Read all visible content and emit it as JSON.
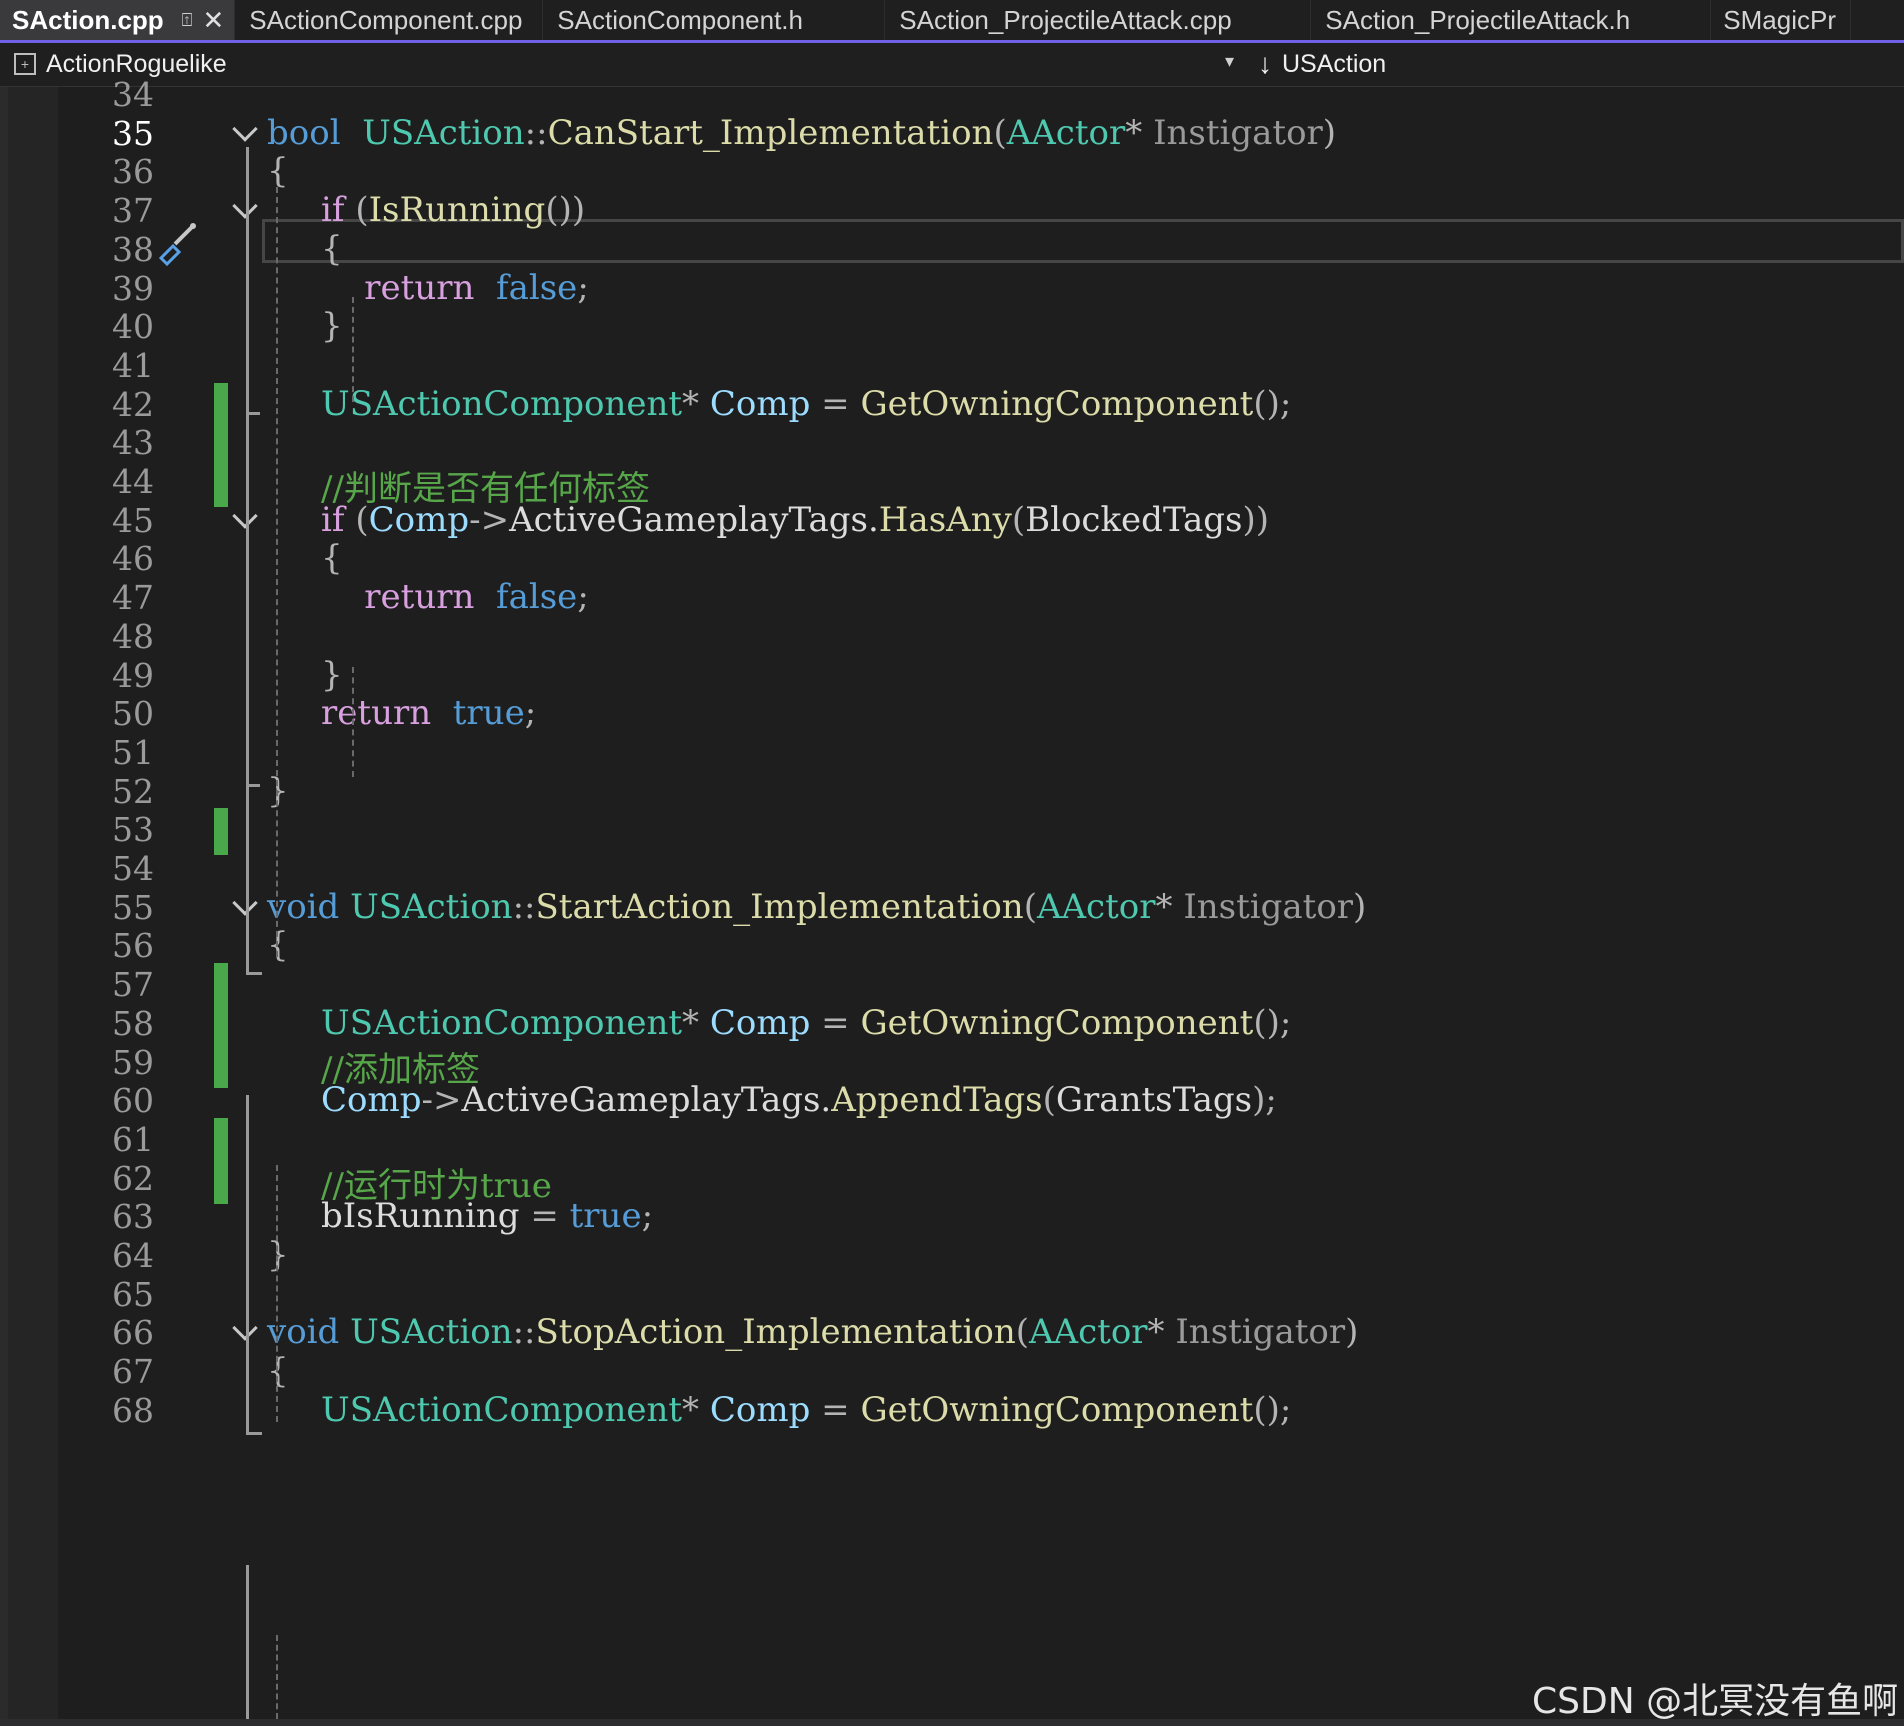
{
  "tabs": [
    {
      "label": "SAction.cpp",
      "active": true
    },
    {
      "label": "SActionComponent.cpp"
    },
    {
      "label": "SActionComponent.h"
    },
    {
      "label": "SAction_ProjectileAttack.cpp"
    },
    {
      "label": "SAction_ProjectileAttack.h"
    },
    {
      "label": "SMagicPr"
    }
  ],
  "navbar": {
    "project": "ActionRoguelike",
    "scope": "USAction"
  },
  "editor": {
    "current_line": "35",
    "lines": [
      {
        "n": "34"
      },
      {
        "n": "35",
        "t": [
          [
            "kw",
            "bool"
          ],
          [
            "",
            "  "
          ],
          [
            "ty",
            "USAction"
          ],
          [
            "pn",
            "::"
          ],
          [
            "fn",
            "CanStart_Implementation"
          ],
          [
            "pn",
            "("
          ],
          [
            "ty",
            "AActor"
          ],
          [
            "pn",
            "* "
          ],
          [
            "prm",
            "Instigator"
          ],
          [
            "pn",
            ")"
          ]
        ]
      },
      {
        "n": "36",
        "t": [
          [
            "pn",
            "{"
          ]
        ]
      },
      {
        "n": "37",
        "t": [
          [
            "",
            "     "
          ],
          [
            "ctl",
            "if"
          ],
          [
            "pn",
            " ("
          ],
          [
            "fn",
            "IsRunning"
          ],
          [
            "pn",
            "())"
          ]
        ]
      },
      {
        "n": "38",
        "t": [
          [
            "",
            "     "
          ],
          [
            "pn",
            "{"
          ]
        ]
      },
      {
        "n": "39",
        "t": [
          [
            "",
            "         "
          ],
          [
            "ctl",
            "return"
          ],
          [
            "",
            "  "
          ],
          [
            "kw",
            "false"
          ],
          [
            "pn",
            ";"
          ]
        ]
      },
      {
        "n": "40",
        "t": [
          [
            "",
            "     "
          ],
          [
            "pn",
            "}"
          ]
        ]
      },
      {
        "n": "41"
      },
      {
        "n": "42",
        "t": [
          [
            "",
            "     "
          ],
          [
            "ty",
            "USActionComponent"
          ],
          [
            "pn",
            "* "
          ],
          [
            "var",
            "Comp"
          ],
          [
            "pn",
            " = "
          ],
          [
            "fn",
            "GetOwningComponent"
          ],
          [
            "pn",
            "();"
          ]
        ]
      },
      {
        "n": "43"
      },
      {
        "n": "44",
        "t": [
          [
            "",
            "     "
          ],
          [
            "cm",
            "//判断是否有任何标签"
          ]
        ]
      },
      {
        "n": "45",
        "t": [
          [
            "",
            "     "
          ],
          [
            "ctl",
            "if"
          ],
          [
            "pn",
            " ("
          ],
          [
            "var",
            "Comp"
          ],
          [
            "pn",
            "->"
          ],
          [
            "",
            "ActiveGameplayTags."
          ],
          [
            "fn",
            "HasAny"
          ],
          [
            "pn",
            "("
          ],
          [
            "",
            "BlockedTags"
          ],
          [
            "pn",
            "))"
          ]
        ]
      },
      {
        "n": "46",
        "t": [
          [
            "",
            "     "
          ],
          [
            "pn",
            "{"
          ]
        ]
      },
      {
        "n": "47",
        "t": [
          [
            "",
            "         "
          ],
          [
            "ctl",
            "return"
          ],
          [
            "",
            "  "
          ],
          [
            "kw",
            "false"
          ],
          [
            "pn",
            ";"
          ]
        ]
      },
      {
        "n": "48"
      },
      {
        "n": "49",
        "t": [
          [
            "",
            "     "
          ],
          [
            "pn",
            "}"
          ]
        ]
      },
      {
        "n": "50",
        "t": [
          [
            "",
            "     "
          ],
          [
            "ctl",
            "return"
          ],
          [
            "",
            "  "
          ],
          [
            "kw",
            "true"
          ],
          [
            "pn",
            ";"
          ]
        ]
      },
      {
        "n": "51"
      },
      {
        "n": "52",
        "t": [
          [
            "pn",
            "}"
          ]
        ]
      },
      {
        "n": "53"
      },
      {
        "n": "54"
      },
      {
        "n": "55",
        "t": [
          [
            "kw",
            "void"
          ],
          [
            "",
            ""
          ],
          [
            "ty",
            " USAction"
          ],
          [
            "pn",
            "::"
          ],
          [
            "fn",
            "StartAction_Implementation"
          ],
          [
            "pn",
            "("
          ],
          [
            "ty",
            "AActor"
          ],
          [
            "pn",
            "* "
          ],
          [
            "prm",
            "Instigator"
          ],
          [
            "pn",
            ")"
          ]
        ]
      },
      {
        "n": "56",
        "t": [
          [
            "pn",
            "{"
          ]
        ]
      },
      {
        "n": "57"
      },
      {
        "n": "58",
        "t": [
          [
            "",
            "     "
          ],
          [
            "ty",
            "USActionComponent"
          ],
          [
            "pn",
            "* "
          ],
          [
            "var",
            "Comp"
          ],
          [
            "pn",
            " = "
          ],
          [
            "fn",
            "GetOwningComponent"
          ],
          [
            "pn",
            "();"
          ]
        ]
      },
      {
        "n": "59",
        "t": [
          [
            "",
            "     "
          ],
          [
            "cm",
            "//添加标签"
          ]
        ]
      },
      {
        "n": "60",
        "t": [
          [
            "",
            "     "
          ],
          [
            "var",
            "Comp"
          ],
          [
            "pn",
            "->"
          ],
          [
            "",
            "ActiveGameplayTags."
          ],
          [
            "fn",
            "AppendTags"
          ],
          [
            "pn",
            "("
          ],
          [
            "",
            "GrantsTags"
          ],
          [
            "pn",
            ");"
          ]
        ]
      },
      {
        "n": "61"
      },
      {
        "n": "62",
        "t": [
          [
            "",
            "     "
          ],
          [
            "cm",
            "//运行时为true"
          ]
        ]
      },
      {
        "n": "63",
        "t": [
          [
            "",
            "     "
          ],
          [
            "",
            "bIsRunning"
          ],
          [
            "pn",
            " = "
          ],
          [
            "kw",
            "true"
          ],
          [
            "pn",
            ";"
          ]
        ]
      },
      {
        "n": "64",
        "t": [
          [
            "pn",
            "}"
          ]
        ]
      },
      {
        "n": "65"
      },
      {
        "n": "66",
        "t": [
          [
            "kw",
            "void"
          ],
          [
            "ty",
            " USAction"
          ],
          [
            "pn",
            "::"
          ],
          [
            "fn",
            "StopAction_Implementation"
          ],
          [
            "pn",
            "("
          ],
          [
            "ty",
            "AActor"
          ],
          [
            "pn",
            "* "
          ],
          [
            "prm",
            "Instigator"
          ],
          [
            "pn",
            ")"
          ]
        ]
      },
      {
        "n": "67",
        "t": [
          [
            "pn",
            "{"
          ]
        ]
      },
      {
        "n": "68",
        "t": [
          [
            "",
            "     "
          ],
          [
            "ty",
            "USActionComponent"
          ],
          [
            "pn",
            "* "
          ],
          [
            "var",
            "Comp"
          ],
          [
            "pn",
            " = "
          ],
          [
            "fn",
            "GetOwningComponent"
          ],
          [
            "pn",
            "();"
          ]
        ]
      }
    ]
  },
  "watermark": "CSDN @北冥没有鱼啊"
}
